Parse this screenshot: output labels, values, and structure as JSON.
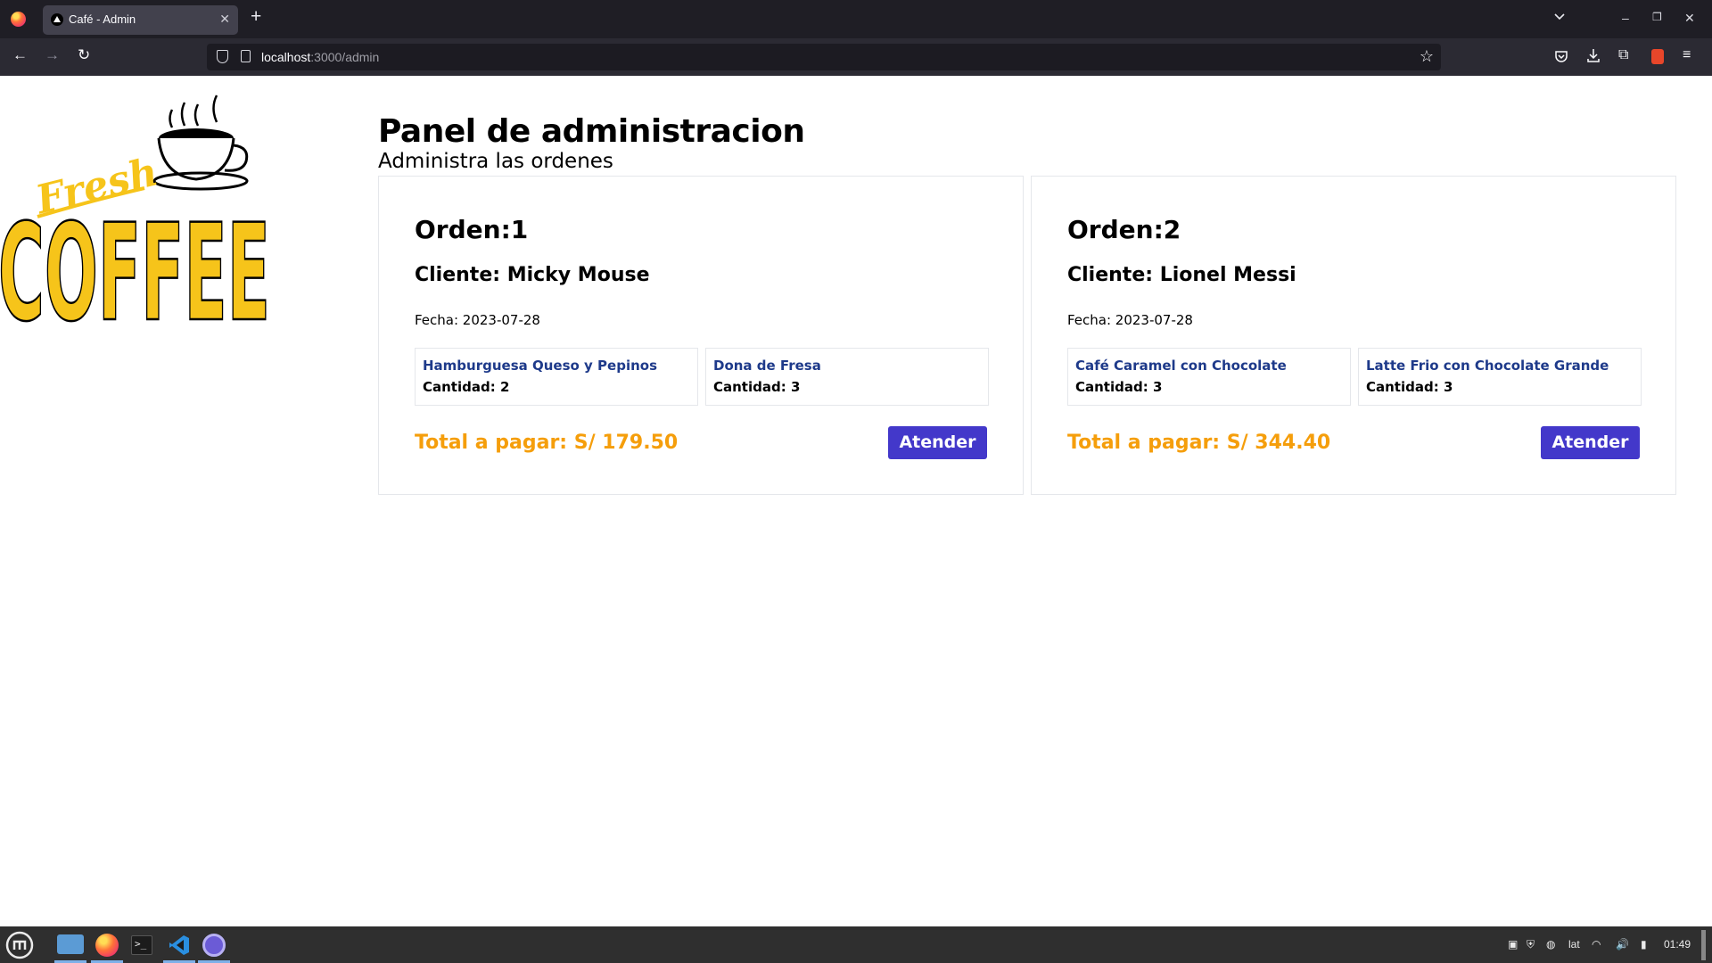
{
  "browser": {
    "tab_title": "Café - Admin",
    "url_host": "localhost",
    "url_path": ":3000/admin"
  },
  "page": {
    "logo_alt": "Fresh COFFEE",
    "title": "Panel de administracion",
    "subtitle": "Administra las ordenes"
  },
  "orders": [
    {
      "title": "Orden:1",
      "client": "Cliente: Micky Mouse",
      "date": "Fecha: 2023-07-28",
      "items": [
        {
          "name": "Hamburguesa Queso y Pepinos",
          "qty": "Cantidad: 2"
        },
        {
          "name": "Dona de Fresa",
          "qty": "Cantidad: 3"
        }
      ],
      "total": "Total a pagar: S/ 179.50",
      "button": "Atender"
    },
    {
      "title": "Orden:2",
      "client": "Cliente: Lionel Messi",
      "date": "Fecha: 2023-07-28",
      "items": [
        {
          "name": "Café Caramel con Chocolate",
          "qty": "Cantidad: 3"
        },
        {
          "name": "Latte Frio con Chocolate Grande",
          "qty": "Cantidad: 3"
        }
      ],
      "total": "Total a pagar: S/ 344.40",
      "button": "Atender"
    }
  ],
  "taskbar": {
    "keyboard_layout": "lat",
    "clock": "01:49"
  },
  "colors": {
    "accent_button": "#4338ca",
    "total_text": "#f59e0b",
    "item_name": "#1e3a8a",
    "logo_yellow": "#f6c41a"
  }
}
